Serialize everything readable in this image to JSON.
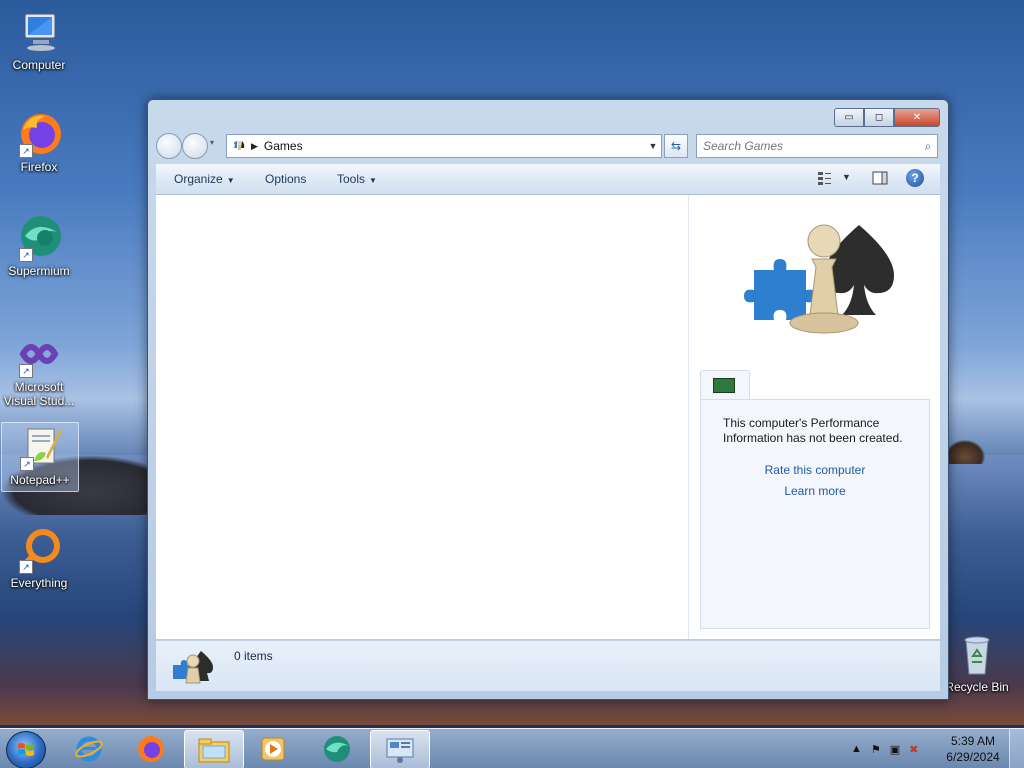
{
  "desktop": {
    "icons": [
      {
        "label": "Computer"
      },
      {
        "label": "Firefox"
      },
      {
        "label": "Supermium"
      },
      {
        "label": "Microsoft Visual Stud..."
      },
      {
        "label": "Notepad++"
      },
      {
        "label": "Everything"
      }
    ],
    "recycle_bin": {
      "label": "Recycle Bin"
    }
  },
  "window": {
    "address": {
      "crumb": "Games"
    },
    "search": {
      "placeholder": "Search Games"
    },
    "toolbar": {
      "organize": "Organize",
      "options": "Options",
      "tools": "Tools"
    },
    "controls": {
      "minimize": "▭",
      "maximize": "◻",
      "close": "✕"
    },
    "preview": {
      "performance_text": "This computer's Performance Information has not been created.",
      "rate_link": "Rate this computer",
      "learn_link": "Learn more"
    },
    "details": {
      "count": "0 items"
    }
  },
  "taskbar": {
    "clock_time": "5:39 AM",
    "clock_date": "6/29/2024",
    "pinned": [
      "internet-explorer",
      "firefox",
      "windows-explorer",
      "media-player",
      "supermium",
      "games-explorer"
    ]
  },
  "colors": {
    "link": "#1e5ba8",
    "accent": "#2e6bc0"
  }
}
